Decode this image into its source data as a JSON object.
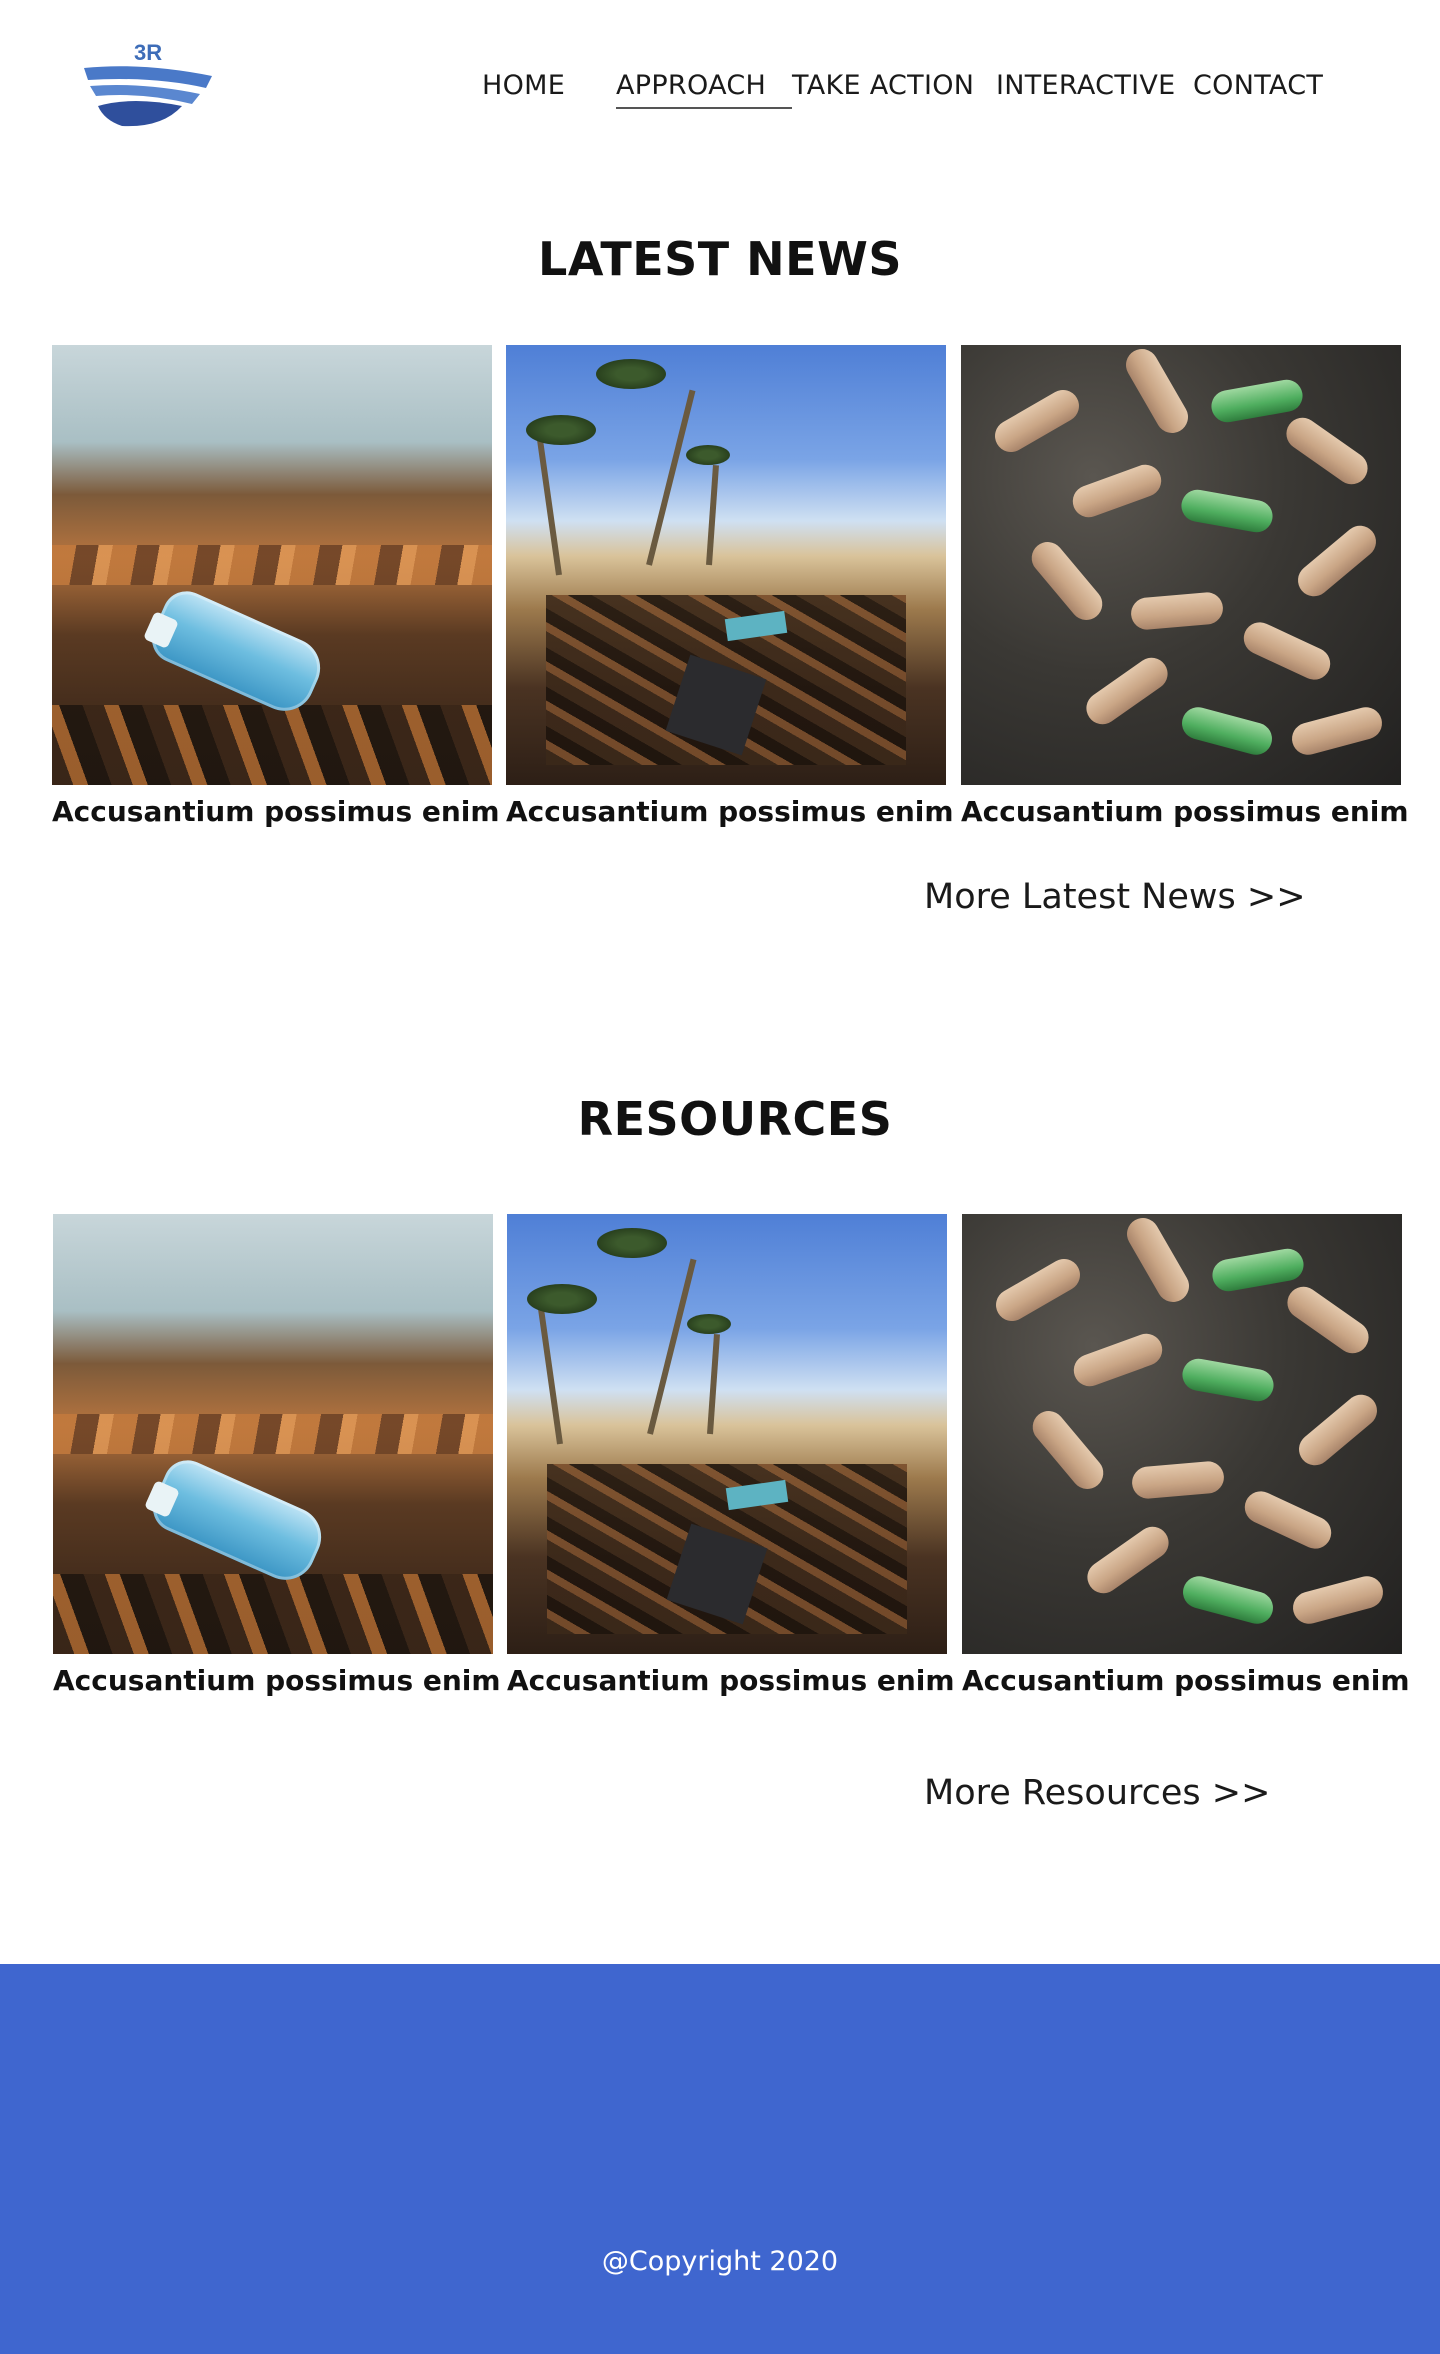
{
  "header": {
    "logo_text": "3R",
    "nav": [
      {
        "label": "HOME"
      },
      {
        "label": "APPROACH",
        "active": true
      },
      {
        "label": "TAKE ACTION"
      },
      {
        "label": "INTERACTIVE"
      },
      {
        "label": "CONTACT"
      }
    ]
  },
  "latest_news": {
    "title": "LATEST NEWS",
    "items": [
      {
        "caption": "Accusantium possimus enim",
        "image": "plastic-bottle-on-seaweed"
      },
      {
        "caption": "Accusantium possimus enim",
        "image": "littered-palm-beach"
      },
      {
        "caption": "Accusantium possimus enim",
        "image": "pile-of-plastic-bottles"
      }
    ],
    "more_label": "More Latest News >>"
  },
  "resources": {
    "title": "RESOURCES",
    "items": [
      {
        "caption": "Accusantium possimus enim",
        "image": "plastic-bottle-on-seaweed"
      },
      {
        "caption": "Accusantium possimus enim",
        "image": "littered-palm-beach"
      },
      {
        "caption": "Accusantium possimus enim",
        "image": "pile-of-plastic-bottles"
      }
    ],
    "more_label": "More Resources >>"
  },
  "footer": {
    "copyright": "@Copyright 2020",
    "background_color": "#3f66cf"
  }
}
